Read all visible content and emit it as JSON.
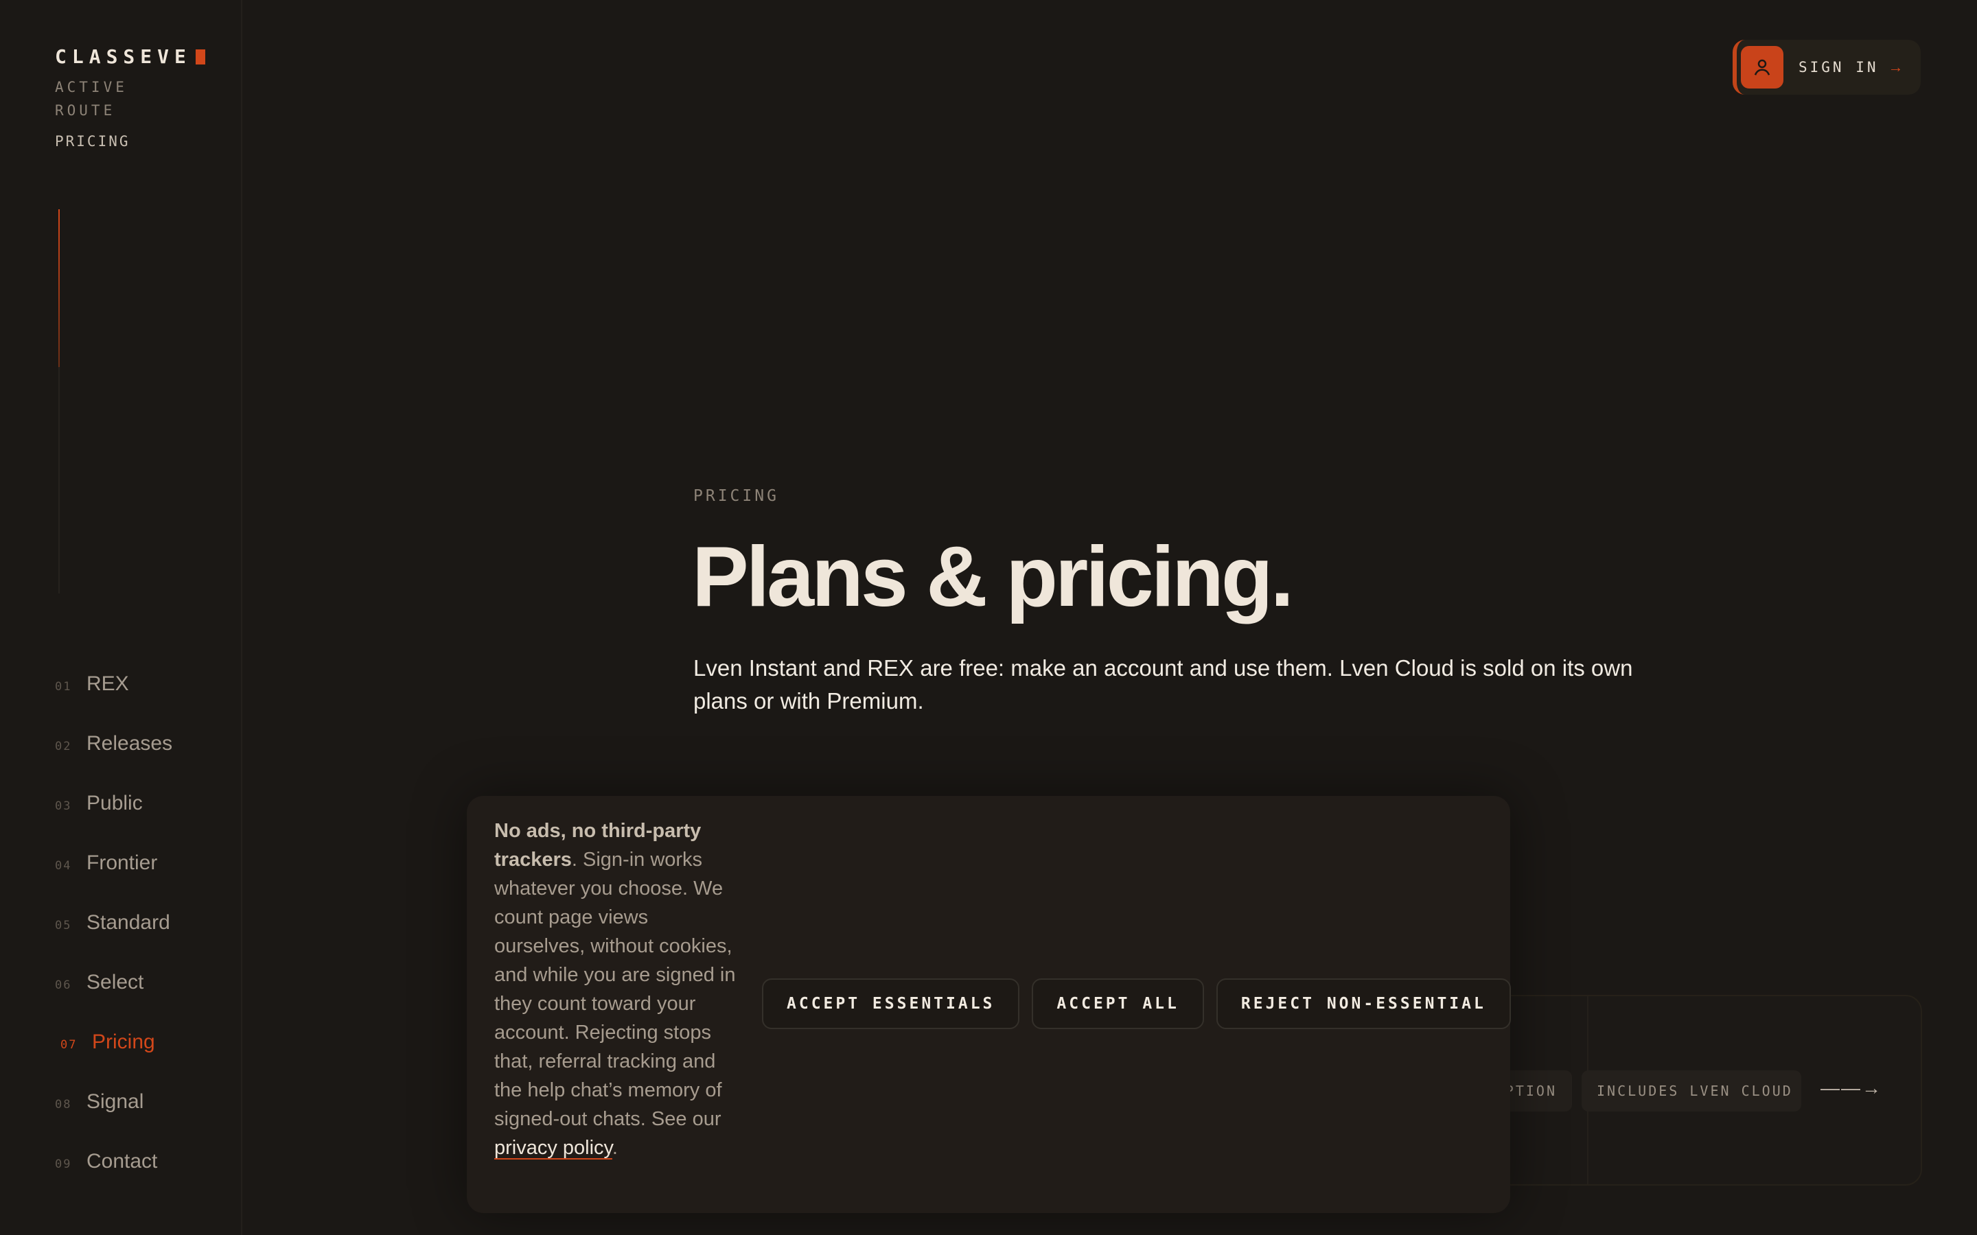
{
  "brand": {
    "name": "CLASSEVE"
  },
  "sidebar": {
    "route_label": "ACTIVE ROUTE",
    "route_value": "PRICING",
    "nav": [
      {
        "num": "01",
        "label": "REX"
      },
      {
        "num": "02",
        "label": "Releases"
      },
      {
        "num": "03",
        "label": "Public"
      },
      {
        "num": "04",
        "label": "Frontier"
      },
      {
        "num": "05",
        "label": "Standard"
      },
      {
        "num": "06",
        "label": "Select"
      },
      {
        "num": "07",
        "label": "Pricing",
        "active": true
      },
      {
        "num": "08",
        "label": "Signal"
      },
      {
        "num": "09",
        "label": "Contact"
      }
    ]
  },
  "header": {
    "signin_label": "SIGN IN",
    "signin_arrow": "→"
  },
  "hero": {
    "eyebrow": "PRICING",
    "title": "Plans & pricing.",
    "lede": "Lven Instant and REX are free: make an account and use them. Lven Cloud is sold on its own plans or with Premium."
  },
  "card": {
    "chip_partial": "PTION",
    "chip_cloud": "INCLUDES LVEN CLOUD",
    "arrow": "——→"
  },
  "consent": {
    "bold": "No ads, no third-party trackers",
    "body": ". Sign-in works whatever you choose. We count page views ourselves, without cookies, and while you are signed in they count toward your account. Rejecting stops that, referral tracking and the help chat’s memory of signed-out chats. See our ",
    "link": "privacy policy",
    "end": ".",
    "buttons": {
      "essentials": "ACCEPT ESSENTIALS",
      "all": "ACCEPT ALL",
      "reject": "REJECT NON-ESSENTIAL"
    }
  },
  "colors": {
    "accent": "#d2471a",
    "background": "#1b1815",
    "text": "#efe6da"
  }
}
